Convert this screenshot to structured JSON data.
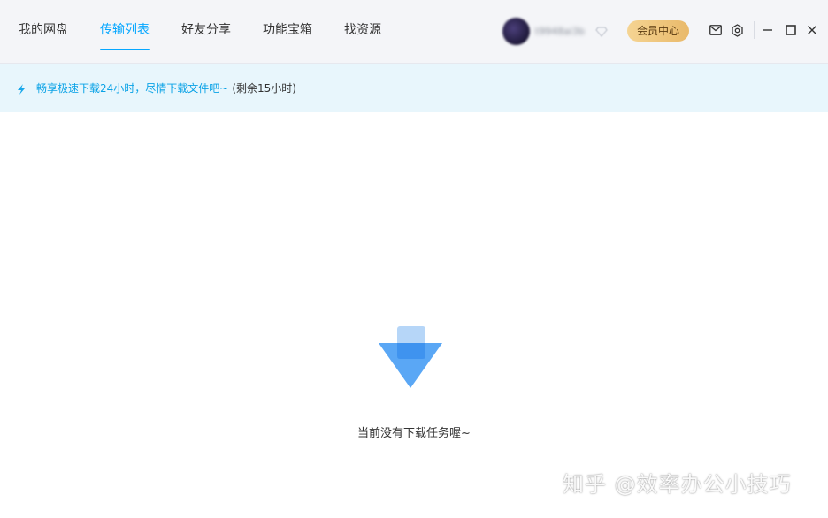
{
  "nav": {
    "tabs": [
      {
        "label": "我的网盘"
      },
      {
        "label": "传输列表"
      },
      {
        "label": "好友分享"
      },
      {
        "label": "功能宝箱"
      },
      {
        "label": "找资源"
      }
    ],
    "active_tab": "传输列表"
  },
  "user": {
    "avatar_icon": "avatar",
    "username": "t9948ai3b",
    "badge_icon": "diamond-icon"
  },
  "header_actions": {
    "vip_center_label": "会员中心",
    "icons": [
      "mail-icon",
      "settings-icon",
      "minimize-icon",
      "maximize-icon",
      "close-icon"
    ]
  },
  "notice": {
    "icon": "lightning-icon",
    "message": "畅享极速下载24小时，尽情下载文件吧~",
    "remaining": "(剩余15小时)"
  },
  "empty_state": {
    "icon": "download-arrow-icon",
    "text": "当前没有下载任务喔~"
  },
  "watermark": {
    "text": "知乎 @效率办公小技巧"
  },
  "colors": {
    "accent": "#06a7ff",
    "vip_gold": "#f0c47a",
    "notice_bg": "#e8f6fc",
    "topbar_bg": "#f4f5f8"
  }
}
